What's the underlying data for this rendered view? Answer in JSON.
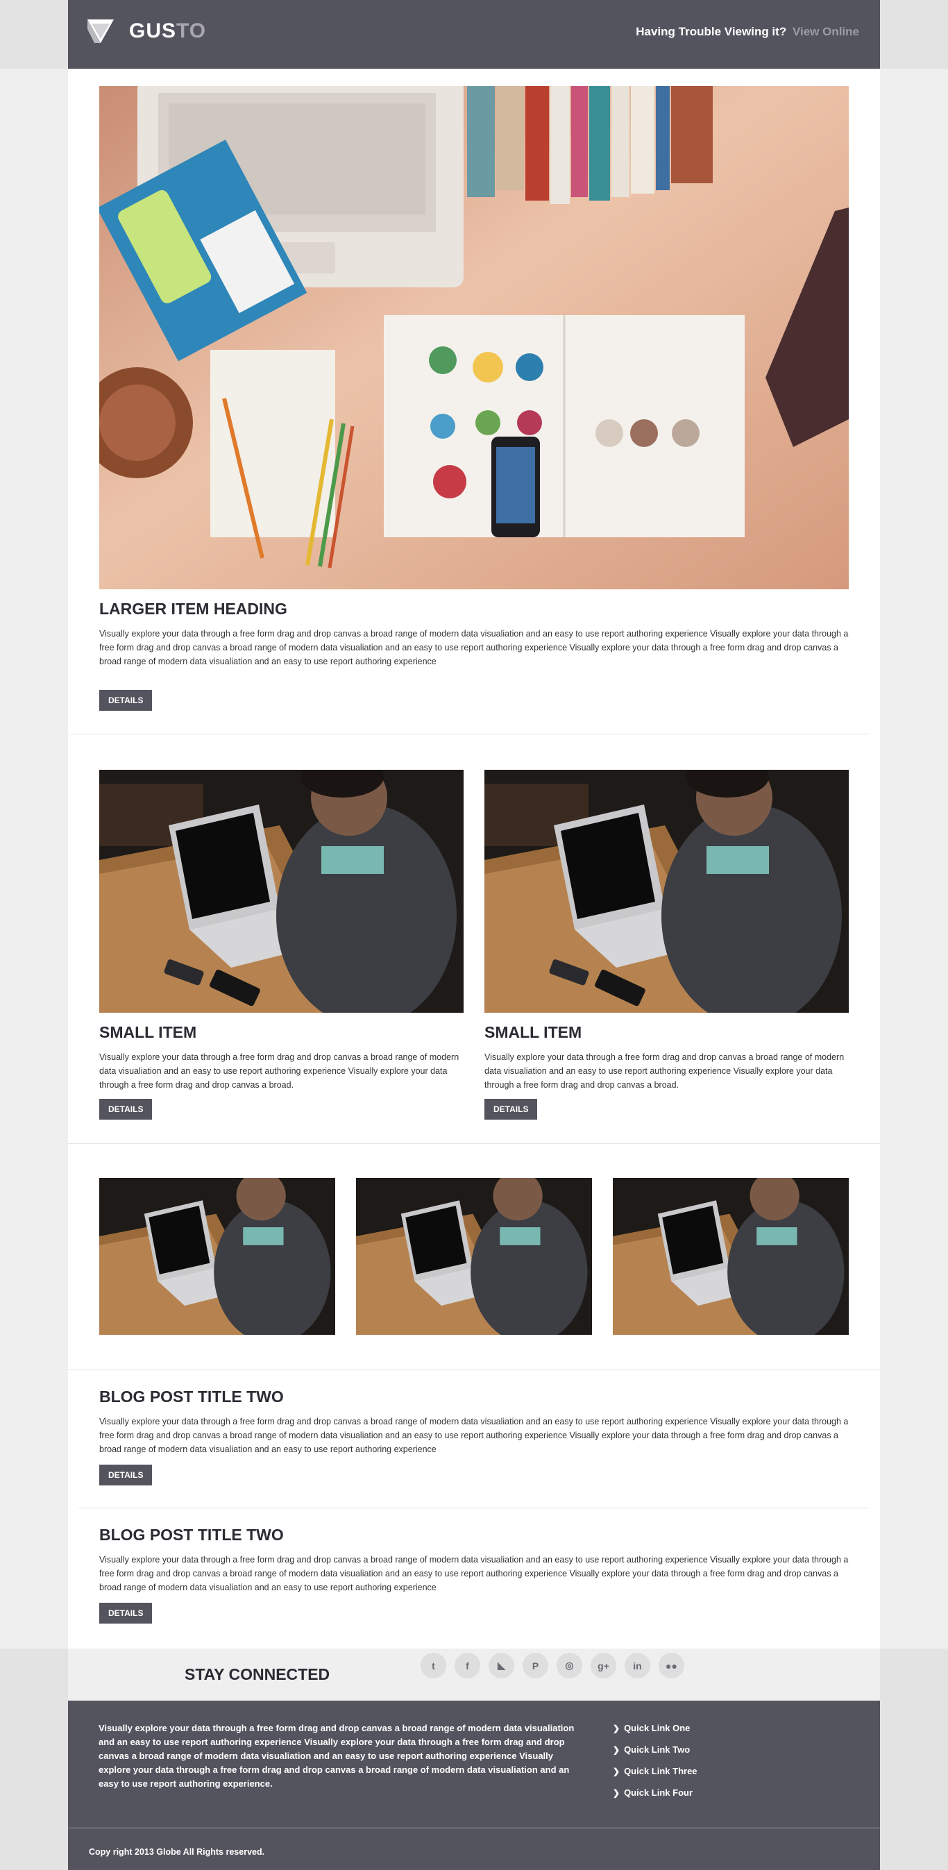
{
  "header": {
    "logo_part1": "GUS",
    "logo_part2": "TO",
    "trouble_text": "Having Trouble Viewing it?",
    "view_online": "View Online"
  },
  "featured": {
    "heading": "LARGER ITEM HEADING",
    "text": "Visually explore your data through a free form drag and drop canvas a broad range of modern data visualiation and an easy to use report authoring experience Visually explore your data through a free form drag and drop canvas a broad range of modern data visualiation and an easy to use report authoring experience Visually explore your data through a free form drag and drop canvas a broad range of modern data visualiation and an easy to use report authoring experience",
    "button": "DETAILS"
  },
  "small_items": [
    {
      "heading": "SMALL ITEM",
      "text": "Visually explore your data through a free form drag and drop canvas a broad range of modern data visualiation and an easy to use report authoring experience Visually explore your data through a free form drag and drop canvas a broad.",
      "button": "DETAILS"
    },
    {
      "heading": "SMALL ITEM",
      "text": "Visually explore your data through a free form drag and drop canvas a broad range of modern data visualiation and an easy to use report authoring experience Visually explore your data through a free form drag and drop canvas a broad.",
      "button": "DETAILS"
    }
  ],
  "blog_posts": [
    {
      "title": "BLOG POST TITLE TWO",
      "text": "Visually explore your data through a free form drag and drop canvas a broad range of modern data visualiation and an easy to use report authoring experience Visually explore your data through a free form drag and drop canvas a broad range of modern data visualiation and an easy to use report authoring experience Visually explore your data through a free form drag and drop canvas a broad range of modern data visualiation and an easy to use report authoring experience",
      "button": "DETAILS"
    },
    {
      "title": "BLOG POST TITLE TWO",
      "text": "Visually explore your data through a free form drag and drop canvas a broad range of modern data visualiation and an easy to use report authoring experience Visually explore your data through a free form drag and drop canvas a broad range of modern data visualiation and an easy to use report authoring experience Visually explore your data through a free form drag and drop canvas a broad range of modern data visualiation and an easy to use report authoring experience",
      "button": "DETAILS"
    }
  ],
  "social": {
    "heading": "STAY CONNECTED",
    "icons": [
      "twitter-icon",
      "facebook-icon",
      "rss-icon",
      "pinterest-icon",
      "dribbble-icon",
      "google-plus-icon",
      "linkedin-icon",
      "flickr-icon"
    ],
    "glyphs": [
      "t",
      "f",
      "◣",
      "P",
      "◎",
      "g+",
      "in",
      "●●"
    ]
  },
  "footer": {
    "text": "Visually explore your data through a free form drag and drop canvas a broad range of modern data visualiation and an easy to use report authoring experience Visually explore your data through a free form drag and drop canvas a broad range of modern data visualiation and an easy to use report authoring experience Visually explore your data through a free form drag and drop canvas a broad range of modern data visualiation and an easy to use report authoring experience.",
    "quick_links": [
      "Quick Link One",
      "Quick Link Two",
      "Quick Link Three",
      "Quick Link Four"
    ],
    "copyright": "Copy right 2013 Globe All Rights reserved."
  },
  "colors": {
    "header_bg": "#54545f",
    "button_bg": "#54545f",
    "page_bg": "#efefef",
    "muted_link": "#9c9ca5"
  }
}
